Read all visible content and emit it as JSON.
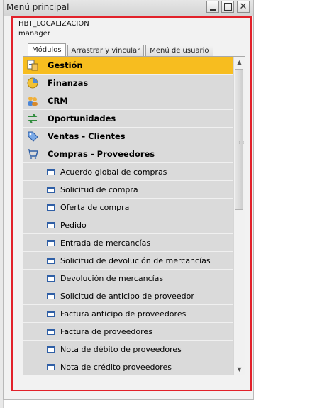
{
  "window": {
    "title": "Menú principal",
    "user_company": "HBT_LOCALIZACION",
    "user_name": "manager"
  },
  "tabs": [
    {
      "label": "Módulos",
      "active": true
    },
    {
      "label": "Arrastrar y vincular",
      "active": false
    },
    {
      "label": "Menú de usuario",
      "active": false
    }
  ],
  "modules": [
    {
      "label": "Gestión",
      "icon": "gestion-icon",
      "selected": true
    },
    {
      "label": "Finanzas",
      "icon": "finanzas-pie-icon"
    },
    {
      "label": "CRM",
      "icon": "crm-people-icon"
    },
    {
      "label": "Oportunidades",
      "icon": "oportunidades-arrows-icon"
    },
    {
      "label": "Ventas - Clientes",
      "icon": "tag-icon"
    },
    {
      "label": "Compras - Proveedores",
      "icon": "cart-icon"
    }
  ],
  "purchase_items": [
    {
      "label": "Acuerdo global de compras"
    },
    {
      "label": "Solicitud de compra"
    },
    {
      "label": "Oferta de compra"
    },
    {
      "label": "Pedido"
    },
    {
      "label": "Entrada de mercancías"
    },
    {
      "label": "Solicitud de devolución de mercancías"
    },
    {
      "label": "Devolución de mercancías"
    },
    {
      "label": "Solicitud de anticipo de proveedor"
    },
    {
      "label": "Factura anticipo de proveedores"
    },
    {
      "label": "Factura de proveedores"
    },
    {
      "label": "Nota de débito de proveedores"
    },
    {
      "label": "Nota de crédito proveedores"
    }
  ],
  "colors": {
    "selected_row": "#f7bd1f",
    "row_bg": "#dadada",
    "highlight_frame": "#e2212a"
  }
}
